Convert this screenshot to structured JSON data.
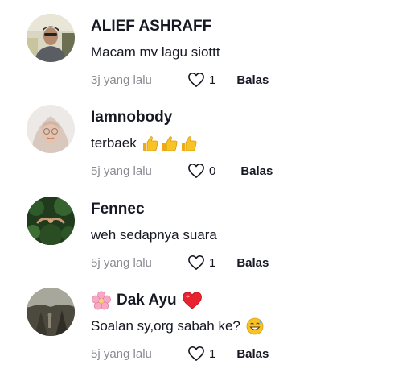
{
  "comments": [
    {
      "username": "ALIEF ASHRAFF",
      "text": "Macam mv lagu siottt",
      "time": "3j yang lalu",
      "likes": "1",
      "reply_label": "Balas",
      "avatar_icon": "man-in-car-avatar"
    },
    {
      "username": "Iamnobody",
      "text": "terbaek",
      "text_emojis": [
        "thumbs-up-icon",
        "thumbs-up-icon",
        "thumbs-up-icon"
      ],
      "time": "5j yang lalu",
      "likes": "0",
      "reply_label": "Balas",
      "avatar_icon": "woman-hijab-avatar"
    },
    {
      "username": "Fennec",
      "text": "weh sedapnya suara",
      "time": "5j yang lalu",
      "likes": "1",
      "reply_label": "Balas",
      "avatar_icon": "forest-avatar"
    },
    {
      "username": "Dak Ayu",
      "username_prefix_icon": "cherry-blossom-icon",
      "username_suffix_icon": "red-heart-icon",
      "text": "Soalan sy,org sabah ke?",
      "text_emojis": [
        "grinning-sweat-icon"
      ],
      "time": "5j yang lalu",
      "likes": "1",
      "reply_label": "Balas",
      "avatar_icon": "landscape-avatar"
    }
  ],
  "colors": {
    "text": "#161823",
    "muted": "#8a8b91",
    "heart_outline": "#161823",
    "heart_red": "#e8232f",
    "emoji_yellow": "#f7c325"
  }
}
